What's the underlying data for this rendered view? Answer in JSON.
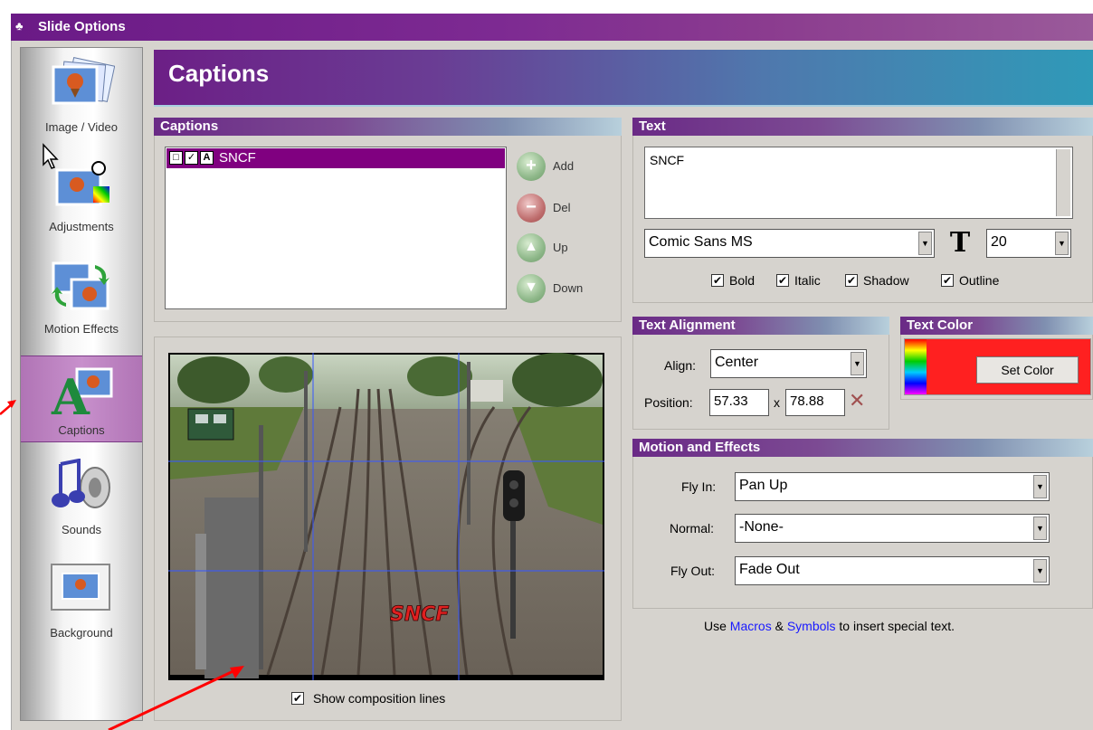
{
  "window": {
    "title": "Slide Options"
  },
  "sidebar": {
    "items": [
      {
        "label": "Image / Video",
        "icon": "image-video-icon"
      },
      {
        "label": "Adjustments",
        "icon": "adjustments-icon"
      },
      {
        "label": "Motion Effects",
        "icon": "motion-effects-icon"
      },
      {
        "label": "Captions",
        "icon": "captions-icon",
        "active": true
      },
      {
        "label": "Sounds",
        "icon": "sounds-icon"
      },
      {
        "label": "Background",
        "icon": "background-icon"
      }
    ]
  },
  "header": {
    "title": "Captions"
  },
  "captions_panel": {
    "title": "Captions",
    "items": [
      {
        "text": "SNCF",
        "selected": true
      }
    ],
    "buttons": {
      "add": "Add",
      "del": "Del",
      "up": "Up",
      "down": "Down"
    }
  },
  "preview": {
    "caption_overlay": "SNCF",
    "show_composition_lines": {
      "label": "Show composition lines",
      "checked": true
    }
  },
  "text_panel": {
    "title": "Text",
    "text_value": "SNCF",
    "font": "Comic Sans MS",
    "size": "20",
    "options": [
      {
        "label": "Bold",
        "checked": true
      },
      {
        "label": "Italic",
        "checked": true
      },
      {
        "label": "Shadow",
        "checked": true
      },
      {
        "label": "Outline",
        "checked": true
      }
    ]
  },
  "alignment_panel": {
    "title": "Text Alignment",
    "align_label": "Align:",
    "align_value": "Center",
    "position_label": "Position:",
    "position_x": "57.33",
    "position_sep": "x",
    "position_y": "78.88"
  },
  "color_panel": {
    "title": "Text Color",
    "button": "Set Color",
    "color": "#ff2020"
  },
  "motion_panel": {
    "title": "Motion and Effects",
    "fly_in_label": "Fly In:",
    "fly_in_value": "Pan Up",
    "normal_label": "Normal:",
    "normal_value": "-None-",
    "fly_out_label": "Fly Out:",
    "fly_out_value": "Fade Out"
  },
  "footer_note": {
    "prefix": "Use ",
    "macros": "Macros",
    "amp": " & ",
    "symbols": "Symbols",
    "suffix": " to insert special text."
  },
  "colors": {
    "accent": "#800080",
    "header_blue": "#2f9ab8",
    "annotation_arrow": "#ff0000"
  }
}
